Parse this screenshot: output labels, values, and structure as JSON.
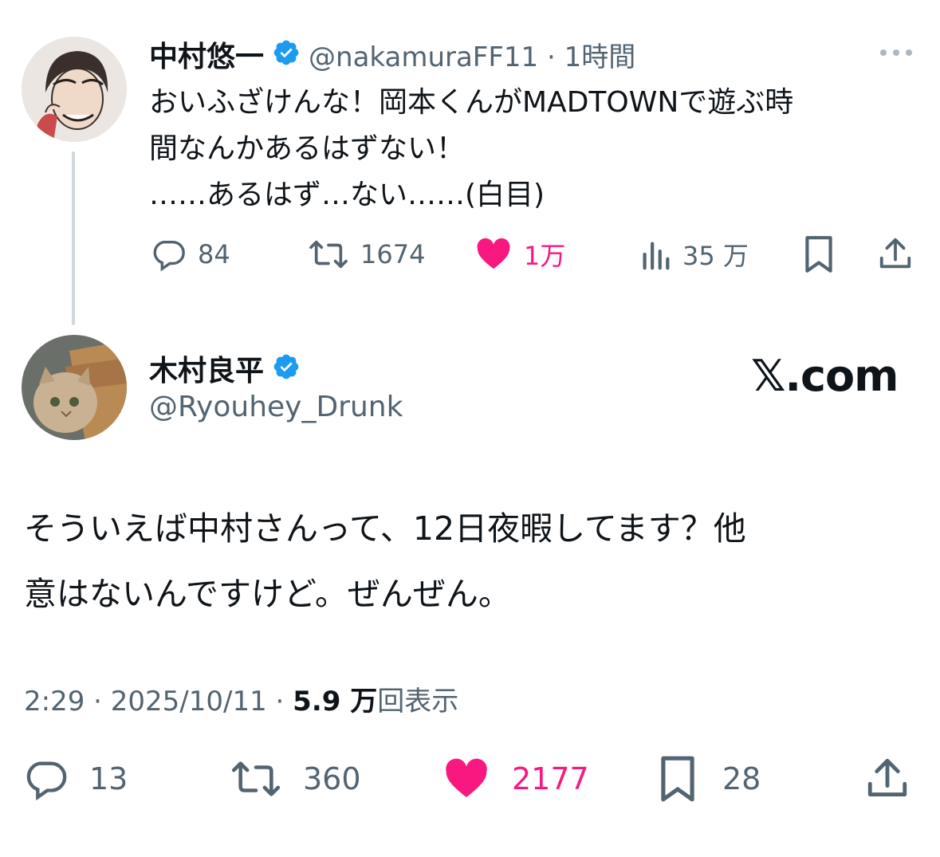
{
  "parent_tweet": {
    "display_name": "中村悠一",
    "handle_time": "@nakamuraFF11 · 1時間",
    "text_line1": "おいふざけんな！岡本くんがMADTOWNで遊ぶ時",
    "text_line2": "間なんかあるはずない！",
    "text_line3": "……あるはず…ない……(白目)",
    "replies": "84",
    "retweets": "1674",
    "likes": "1万",
    "views": "35 万"
  },
  "main_tweet": {
    "display_name": "木村良平",
    "handle": "@Ryouhey_Drunk",
    "source": "𝕏.com",
    "text_line1": "そういえば中村さんって、12日夜暇してます？他",
    "text_line2": "意はないんですけど。ぜんぜん。",
    "time": "2:29 · 2025/10/11 · ",
    "views_count": "5.9 万",
    "views_label": "回表示",
    "replies": "13",
    "retweets": "360",
    "likes": "2177",
    "bookmarks": "28"
  },
  "colors": {
    "like": "#f91880",
    "verified": "#1d9bf0",
    "secondary_text": "#536471",
    "thread_line": "#cfd9de"
  },
  "icons": [
    "reply-icon",
    "retweet-icon",
    "heart-icon",
    "views-icon",
    "bookmark-icon",
    "share-icon",
    "more-icon",
    "verified-icon"
  ]
}
